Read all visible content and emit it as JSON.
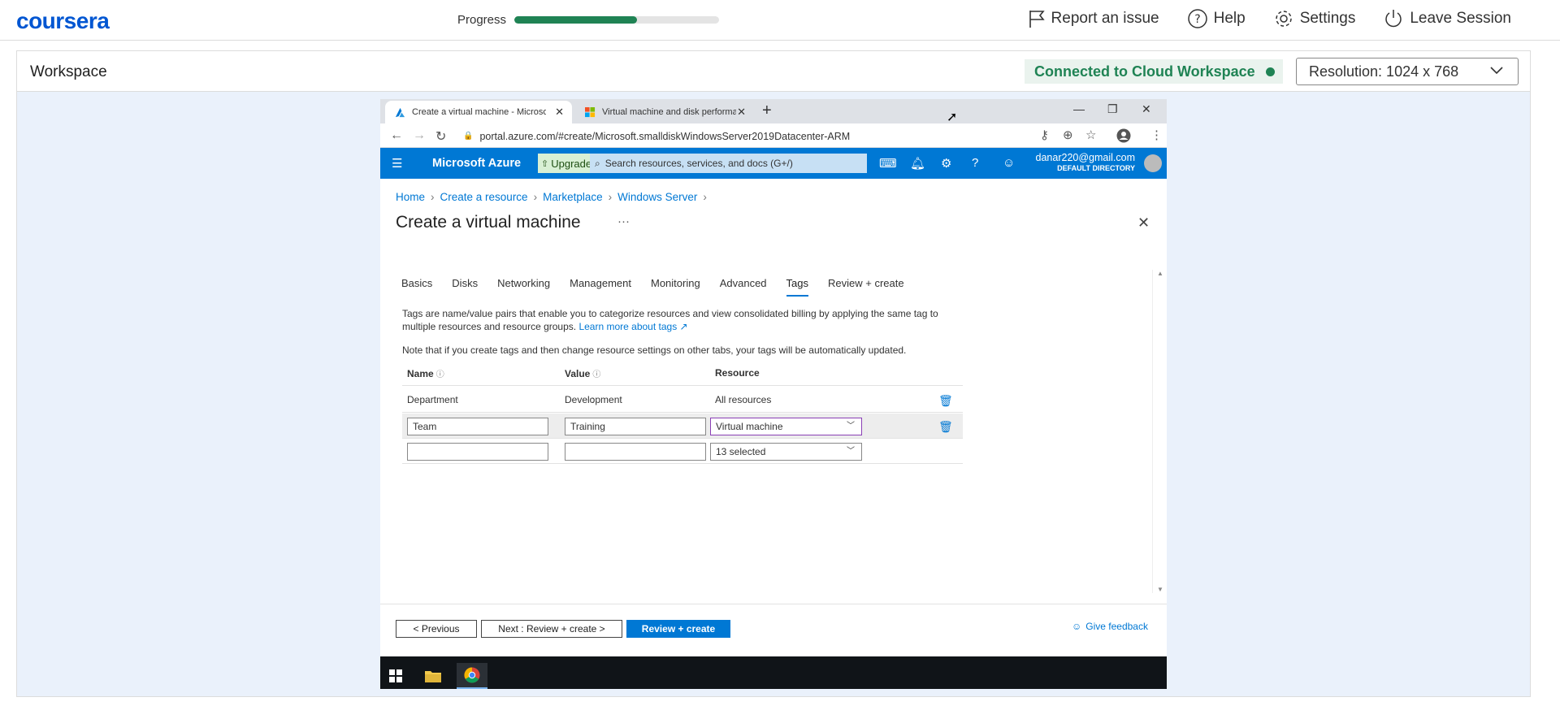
{
  "coursera": {
    "logo": "coursera",
    "progress_label": "Progress",
    "progress_fraction": 0.6,
    "actions": [
      "Report an issue",
      "Help",
      "Settings",
      "Leave Session"
    ]
  },
  "workspace": {
    "title": "Workspace",
    "connected_label": "Connected to Cloud Workspace",
    "resolution_label": "Resolution:  1024 x 768"
  },
  "browser": {
    "tabs": [
      {
        "title": "Create a virtual machine - Microsoft Azure",
        "active": true
      },
      {
        "title": "Virtual machine and disk performance",
        "active": false
      }
    ],
    "url": "portal.azure.com/#create/Microsoft.smalldiskWindowsServer2019Datacenter-ARM"
  },
  "azure": {
    "brand": "Microsoft Azure",
    "upgrade_label": "Upgrade",
    "search_placeholder": "Search resources, services, and docs (G+/)",
    "user_email": "danar220@gmail.com",
    "user_directory": "DEFAULT DIRECTORY",
    "breadcrumb": [
      "Home",
      "Create a resource",
      "Marketplace",
      "Windows Server"
    ],
    "page_title": "Create a virtual machine",
    "tabs": [
      "Basics",
      "Disks",
      "Networking",
      "Management",
      "Monitoring",
      "Advanced",
      "Tags",
      "Review + create"
    ],
    "selected_tab": "Tags",
    "description_line1": "Tags are name/value pairs that enable you to categorize resources and view consolidated billing by applying the same tag to",
    "description_line2": "multiple resources and resource groups.",
    "learn_more": "Learn more about tags",
    "note": "Note that if you create tags and then change resource settings on other tabs, your tags will be automatically updated.",
    "table": {
      "headers": [
        "Name",
        "Value",
        "Resource"
      ],
      "rows": [
        {
          "name": "Department",
          "value": "Development",
          "resource": "All resources"
        },
        {
          "name": "Team",
          "value": "Training",
          "resource": "Virtual machine"
        },
        {
          "name": "",
          "value": "",
          "resource": "13 selected"
        }
      ]
    },
    "footer": {
      "previous": "< Previous",
      "next": "Next : Review + create >",
      "review": "Review + create",
      "feedback": "Give feedback"
    }
  }
}
